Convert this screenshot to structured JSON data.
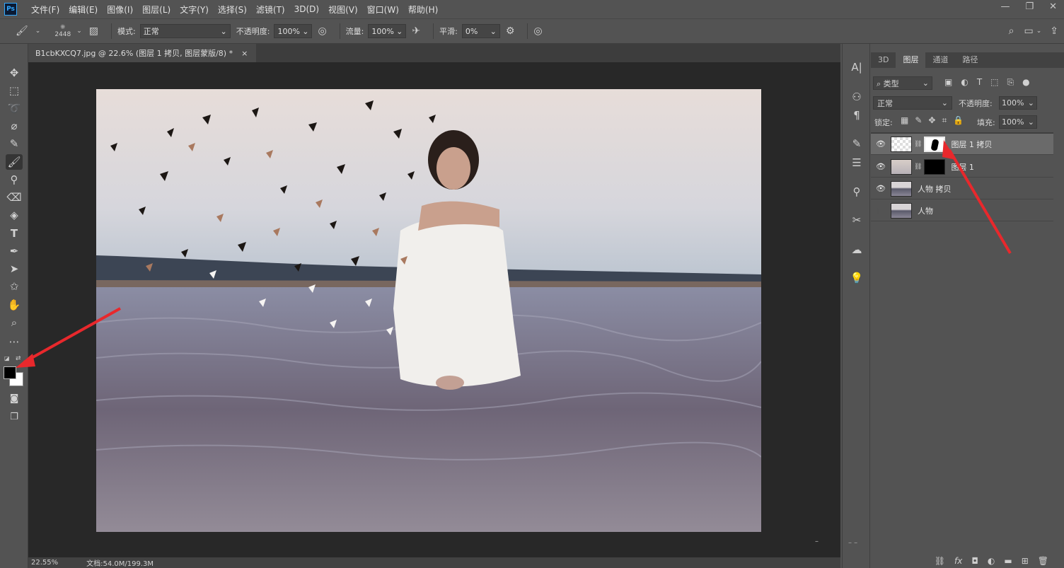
{
  "app": {
    "logo": "Ps",
    "menu": [
      "文件(F)",
      "编辑(E)",
      "图像(I)",
      "图层(L)",
      "文字(Y)",
      "选择(S)",
      "滤镜(T)",
      "3D(D)",
      "视图(V)",
      "窗口(W)",
      "帮助(H)"
    ]
  },
  "options": {
    "brush_size": "2448",
    "mode_label": "模式:",
    "mode_value": "正常",
    "opacity_label": "不透明度:",
    "opacity_value": "100%",
    "flow_label": "流量:",
    "flow_value": "100%",
    "smooth_label": "平滑:",
    "smooth_value": "0%"
  },
  "document": {
    "tab_title": "B1cbKXCQ7.jpg @ 22.6% (图层 1 拷贝, 图层蒙版/8) *",
    "close": "×",
    "zoom": "22.55%",
    "doc_info": "文档:54.0M/199.3M"
  },
  "layers_panel": {
    "tabs": [
      "3D",
      "图层",
      "通道",
      "路径"
    ],
    "active_tab": "图层",
    "filter_label": "类型",
    "blend_mode": "正常",
    "opacity_label": "不透明度:",
    "opacity_value": "100%",
    "lock_label": "锁定:",
    "fill_label": "填充:",
    "fill_value": "100%",
    "layers": [
      {
        "name": "图层 1 拷贝",
        "visible": true,
        "selected": true
      },
      {
        "name": "图层 1",
        "visible": true,
        "selected": false
      },
      {
        "name": "人物 拷贝",
        "visible": true,
        "selected": false
      },
      {
        "name": "人物",
        "visible": false,
        "selected": false
      }
    ],
    "bottom_icons": [
      "link-icon",
      "fx-icon",
      "mask-icon",
      "adjustment-icon",
      "folder-icon",
      "new-layer-icon",
      "trash-icon"
    ]
  },
  "colors": {
    "annotation_arrow": "#e8282c",
    "foreground": "#000000",
    "background": "#ffffff"
  }
}
